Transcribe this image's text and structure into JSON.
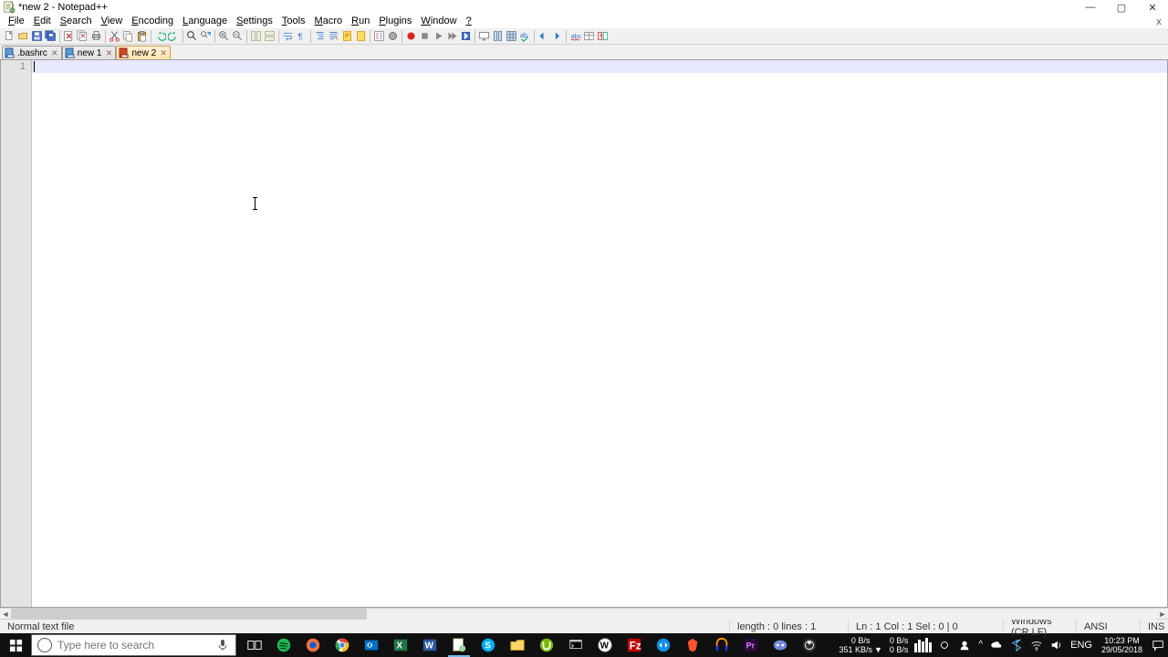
{
  "window": {
    "title": "*new 2 - Notepad++",
    "controls": {
      "min": "—",
      "max": "▢",
      "close": "✕"
    },
    "doc_close": "x"
  },
  "menus": {
    "items": [
      {
        "pre": "",
        "ul": "F",
        "post": "ile"
      },
      {
        "pre": "",
        "ul": "E",
        "post": "dit"
      },
      {
        "pre": "",
        "ul": "S",
        "post": "earch"
      },
      {
        "pre": "",
        "ul": "V",
        "post": "iew"
      },
      {
        "pre": "",
        "ul": "E",
        "post": "ncoding"
      },
      {
        "pre": "",
        "ul": "L",
        "post": "anguage"
      },
      {
        "pre": "",
        "ul": "S",
        "post": "ettings"
      },
      {
        "pre": "",
        "ul": "T",
        "post": "ools"
      },
      {
        "pre": "",
        "ul": "M",
        "post": "acro"
      },
      {
        "pre": "",
        "ul": "R",
        "post": "un"
      },
      {
        "pre": "",
        "ul": "P",
        "post": "lugins"
      },
      {
        "pre": "",
        "ul": "W",
        "post": "indow"
      },
      {
        "pre": "",
        "ul": "?",
        "post": ""
      }
    ]
  },
  "toolbar": {
    "buttons": [
      "new",
      "open",
      "save",
      "save-all",
      "close",
      "close-all",
      "print",
      "cut",
      "copy",
      "paste",
      "undo",
      "redo",
      "find",
      "replace",
      "zoom-in",
      "zoom-out",
      "sync-v",
      "sync-h",
      "wrap",
      "all-chars",
      "indent",
      "outdent",
      "fold",
      "unfold",
      "hide-lines",
      "comment",
      "doc-map",
      "func-list",
      "record",
      "stop",
      "play",
      "play-multi",
      "save-macro",
      "monitor",
      "spell",
      "spell-next",
      "spell-prev",
      "lang",
      "panel1",
      "panel2",
      "compare"
    ]
  },
  "tabs": {
    "items": [
      {
        "label": ".bashrc",
        "color": "blue",
        "active": false
      },
      {
        "label": "new 1",
        "color": "blue",
        "active": false
      },
      {
        "label": "new 2",
        "color": "red",
        "active": true
      }
    ],
    "close_glyph": "✕"
  },
  "editor": {
    "line_numbers": [
      "1"
    ]
  },
  "statusbar": {
    "filetype": "Normal text file",
    "length_lines": "length : 0    lines : 1",
    "position": "Ln : 1    Col : 1    Sel : 0 | 0",
    "eol": "Windows (CR LF)",
    "encoding": "ANSI",
    "mode": "INS"
  },
  "taskbar": {
    "search_placeholder": "Type here to search",
    "net1": {
      "up": "0 B/s",
      "down": "351 KB/s"
    },
    "net2": {
      "up": "0 B/s",
      "down": "0 B/s"
    },
    "lang": "ENG",
    "time": "10:23 PM",
    "date": "29/05/2018"
  }
}
